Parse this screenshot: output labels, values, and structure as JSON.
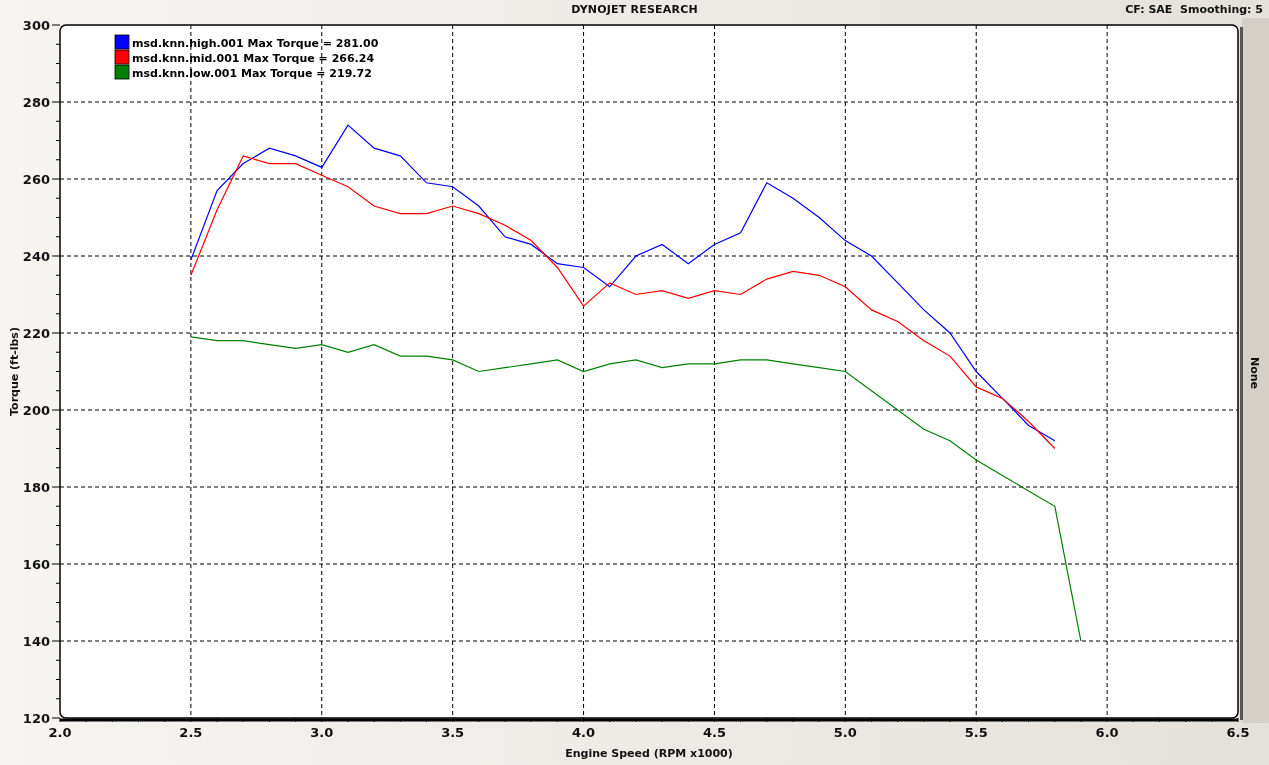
{
  "header": {
    "title": "DYNOJET RESEARCH",
    "settings": "CF: SAE  Smoothing: 5"
  },
  "side_label": "None",
  "chart_data": {
    "type": "line",
    "xlabel": "Engine Speed (RPM x1000)",
    "ylabel": "Torque (ft-lbs)",
    "x": [
      2.5,
      2.6,
      2.7,
      2.8,
      2.9,
      3.0,
      3.1,
      3.2,
      3.3,
      3.4,
      3.5,
      3.6,
      3.7,
      3.8,
      3.9,
      4.0,
      4.1,
      4.2,
      4.3,
      4.4,
      4.5,
      4.6,
      4.7,
      4.8,
      4.9,
      5.0,
      5.1,
      5.2,
      5.3,
      5.4,
      5.5,
      5.6,
      5.7,
      5.8,
      5.9
    ],
    "series": [
      {
        "name": "msd.knn.high.001 Max Torque = 281.00",
        "color": "#0000ff",
        "values": [
          239,
          257,
          264,
          268,
          266,
          263,
          274,
          268,
          266,
          259,
          258,
          253,
          245,
          243,
          238,
          237,
          232,
          240,
          243,
          238,
          243,
          246,
          259,
          255,
          250,
          244,
          240,
          233,
          226,
          220,
          210,
          203,
          196,
          192,
          null
        ]
      },
      {
        "name": "msd.knn.mid.001 Max Torque = 266.24",
        "color": "#ff0000",
        "values": [
          235,
          252,
          266,
          264,
          264,
          261,
          258,
          253,
          251,
          251,
          253,
          251,
          248,
          244,
          237,
          227,
          233,
          230,
          231,
          229,
          231,
          230,
          234,
          236,
          235,
          232,
          226,
          223,
          218,
          214,
          206,
          203,
          197,
          190,
          null
        ]
      },
      {
        "name": "msd.knn.low.001 Max Torque = 219.72",
        "color": "#008000",
        "values": [
          219,
          218,
          218,
          217,
          216,
          217,
          215,
          217,
          214,
          214,
          213,
          210,
          211,
          212,
          213,
          210,
          212,
          213,
          211,
          212,
          212,
          213,
          213,
          212,
          211,
          210,
          205,
          200,
          195,
          192,
          187,
          183,
          179,
          175,
          140
        ]
      }
    ],
    "grid": true,
    "legend": true,
    "xlim": [
      2.0,
      6.5
    ],
    "ylim": [
      120,
      300
    ],
    "xticks": [
      {
        "value": 2,
        "label": "2.0"
      },
      {
        "value": 2.5,
        "label": "2.5"
      },
      {
        "value": 3,
        "label": "3.0"
      },
      {
        "value": 3.5,
        "label": "3.5"
      },
      {
        "value": 4,
        "label": "4.0"
      },
      {
        "value": 4.5,
        "label": "4.5"
      },
      {
        "value": 5,
        "label": "5.0"
      },
      {
        "value": 5.5,
        "label": "5.5"
      },
      {
        "value": 6,
        "label": "6.0"
      },
      {
        "value": 6.5,
        "label": "6.5"
      }
    ],
    "yticks": [
      120,
      140,
      160,
      180,
      200,
      220,
      240,
      260,
      280,
      300
    ]
  }
}
